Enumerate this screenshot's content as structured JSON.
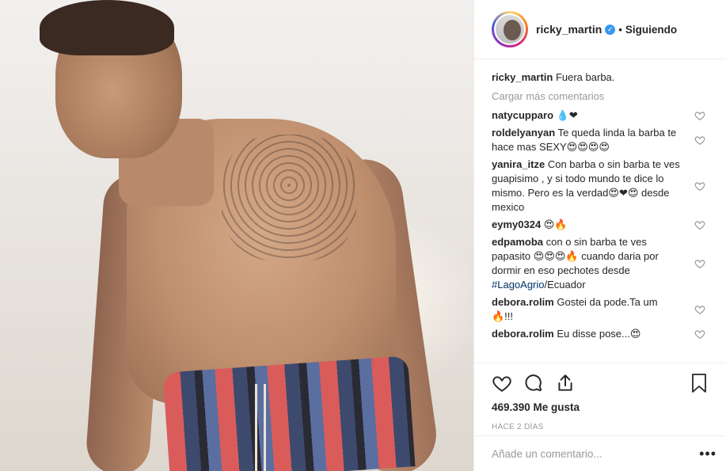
{
  "header": {
    "username": "ricky_martin",
    "separator": "•",
    "follow_status": "Siguiendo"
  },
  "caption": {
    "username": "ricky_martin",
    "text": "Fuera barba."
  },
  "load_more": "Cargar más comentarios",
  "comments": [
    {
      "user": "natycupparo",
      "text": "💧❤"
    },
    {
      "user": "roldelyanyan",
      "text": "Te queda linda la barba te hace mas SEXY😍😍😍😍"
    },
    {
      "user": "yanira_itze",
      "text": "Con barba o sin barba te ves guapisimo , y si todo mundo te dice lo mismo. Pero es la verdad😍❤😍 desde mexico"
    },
    {
      "user": "eymy0324",
      "text": "😍🔥"
    },
    {
      "user": "edpamoba",
      "text_before": "con o sin barba te ves papasito 😍😍😍🔥 cuando daria por dormir en eso pechotes desde ",
      "hashtag": "#LagoAgrio",
      "text_after": "/Ecuador"
    },
    {
      "user": "debora.rolim",
      "text": "Gostei da pode.Ta um 🔥!!!"
    },
    {
      "user": "debora.rolim",
      "text": "Eu disse pose...😍"
    }
  ],
  "likes": "469.390 Me gusta",
  "timestamp": "HACE 2 DÍAS",
  "add_comment": {
    "placeholder": "Añade un comentario...",
    "more": "•••"
  },
  "icons": {
    "verified": "verified-badge-icon",
    "like": "heart-icon",
    "comment": "comment-bubble-icon",
    "share": "share-icon",
    "save": "bookmark-icon",
    "comment_like": "heart-outline-icon",
    "more": "more-options-icon"
  },
  "colors": {
    "verified": "#3897f0",
    "muted": "#999999",
    "link": "#003569"
  }
}
